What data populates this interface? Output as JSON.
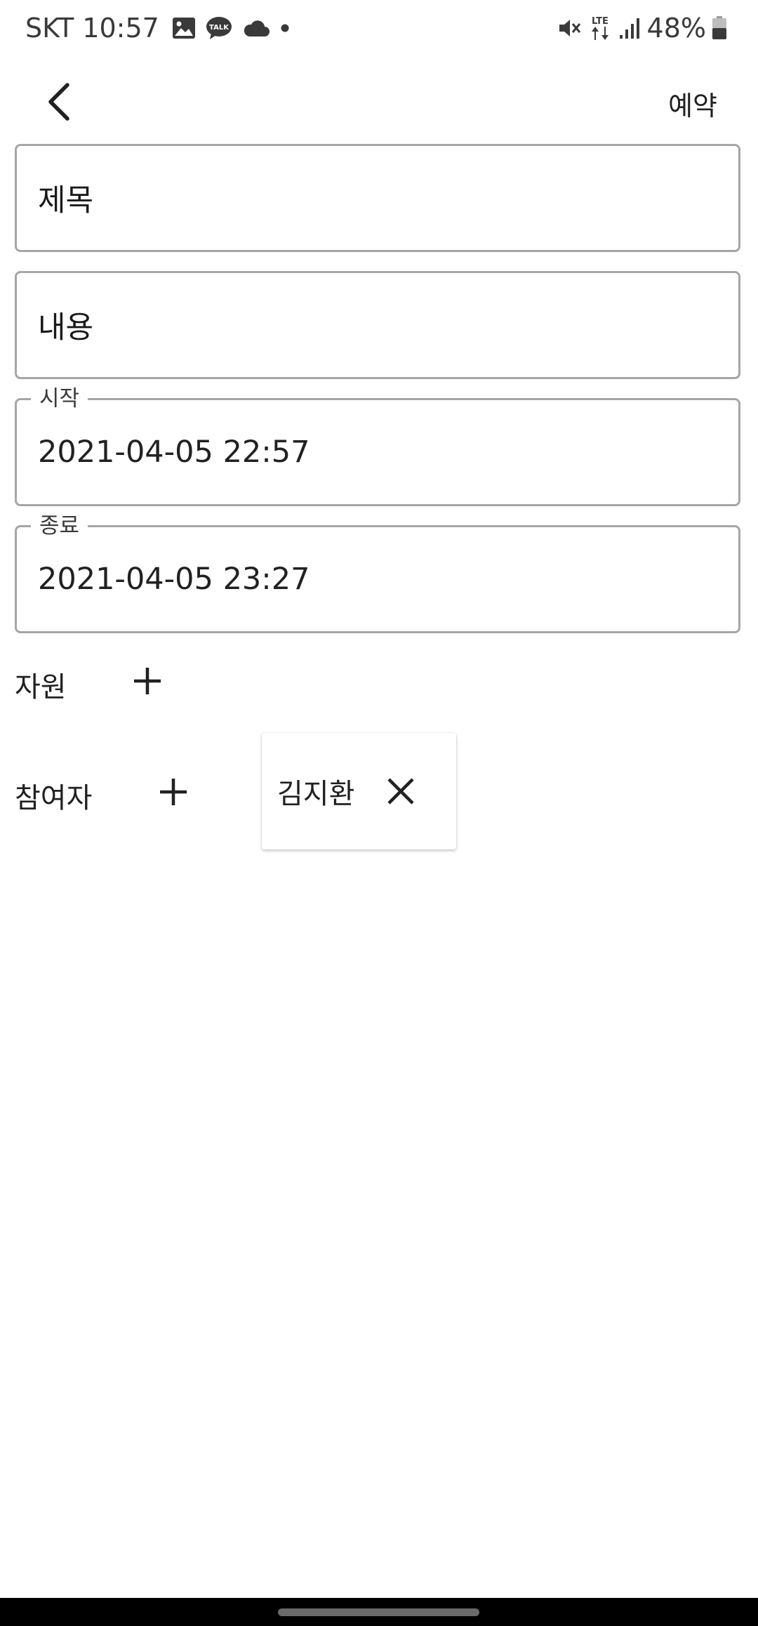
{
  "status_bar": {
    "carrier": "SKT",
    "time": "10:57",
    "left_icons": [
      "image-icon",
      "kakaotalk-icon",
      "cloud-icon",
      "dot-icon"
    ],
    "right_icons": [
      "vibrate-mute-icon",
      "lte-icon",
      "signal-icon",
      "battery-icon"
    ],
    "lte_text": "LTE",
    "talk_text": "TALK",
    "battery_percent": "48%"
  },
  "app_bar": {
    "back_icon": "chevron-left-icon",
    "action_label": "예약"
  },
  "form": {
    "title": {
      "placeholder": "제목"
    },
    "content": {
      "placeholder": "내용"
    },
    "start": {
      "label": "시작",
      "value": "2021-04-05 22:57"
    },
    "end": {
      "label": "종료",
      "value": "2021-04-05 23:27"
    }
  },
  "resources": {
    "label": "자원",
    "add_icon": "plus-icon"
  },
  "participants": {
    "label": "참여자",
    "add_icon": "plus-icon",
    "chips": [
      {
        "name": "김지환",
        "remove_icon": "close-icon"
      }
    ]
  },
  "colors": {
    "background": "#ffffff",
    "text": "#212121",
    "field_border": "#a6a6a6",
    "nav_bar": "#000000"
  }
}
